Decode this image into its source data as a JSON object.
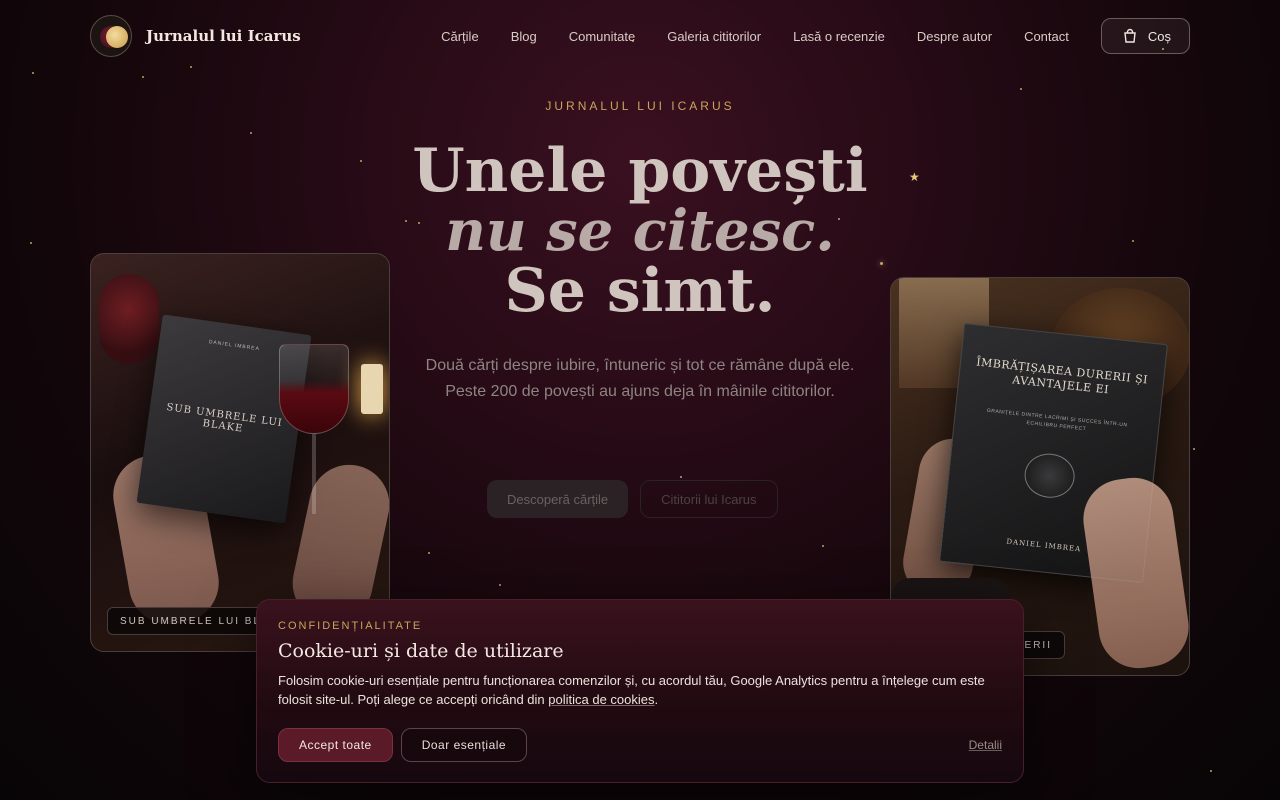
{
  "header": {
    "brand": "Jurnalul lui Icarus",
    "nav": [
      "Cărțile",
      "Blog",
      "Comunitate",
      "Galeria cititorilor",
      "Lasă o recenzie",
      "Despre autor",
      "Contact"
    ],
    "cart_label": "Coș",
    "cart_icon": "shopping-bag-icon"
  },
  "hero": {
    "eyebrow": "JURNALUL LUI ICARUS",
    "headline_line1": "Unele povești",
    "headline_line2": "nu se citesc.",
    "headline_line3": "Se simt.",
    "subtitle": "Două cărți despre iubire, întuneric și tot ce rămâne după ele. Peste 200 de povești au ajuns deja în mâinile cititorilor.",
    "primary_cta": "Descoperă cărțile",
    "secondary_cta": "Cititorii lui Icarus"
  },
  "books": {
    "left": {
      "label": "SUB UMBRELE LUI BLAKE",
      "cover_author": "DANIEL IMBREA",
      "cover_title": "SUB UMBRELE LUI BLAKE"
    },
    "right": {
      "label": "ÎMBRĂȚIȘAREA DURERII",
      "cover_title": "ÎMBRĂȚIȘAREA DURERII ȘI AVANTAJELE EI",
      "cover_subtitle": "GRANIȚELE DINTRE LACRIMI ȘI SUCCES ÎNTR-UN ECHILIBRU PERFECT",
      "cover_author": "DANIEL IMBREA"
    }
  },
  "cookie": {
    "kicker": "CONFIDENȚIALITATE",
    "title": "Cookie-uri și date de utilizare",
    "body_start": "Folosim cookie-uri esențiale pentru funcționarea comenzilor și, cu acordul tău, Google Analytics pentru a înțelege cum este folosit site-ul. Poți alege ce accepți oricând din ",
    "body_link": "politica de cookies",
    "body_end": ".",
    "accept_all": "Accept toate",
    "essential_only": "Doar esențiale",
    "details": "Detalii"
  },
  "colors": {
    "accent_gold": "#c9a45c",
    "accept_button": "#5a1a28",
    "background": "#240a14"
  }
}
